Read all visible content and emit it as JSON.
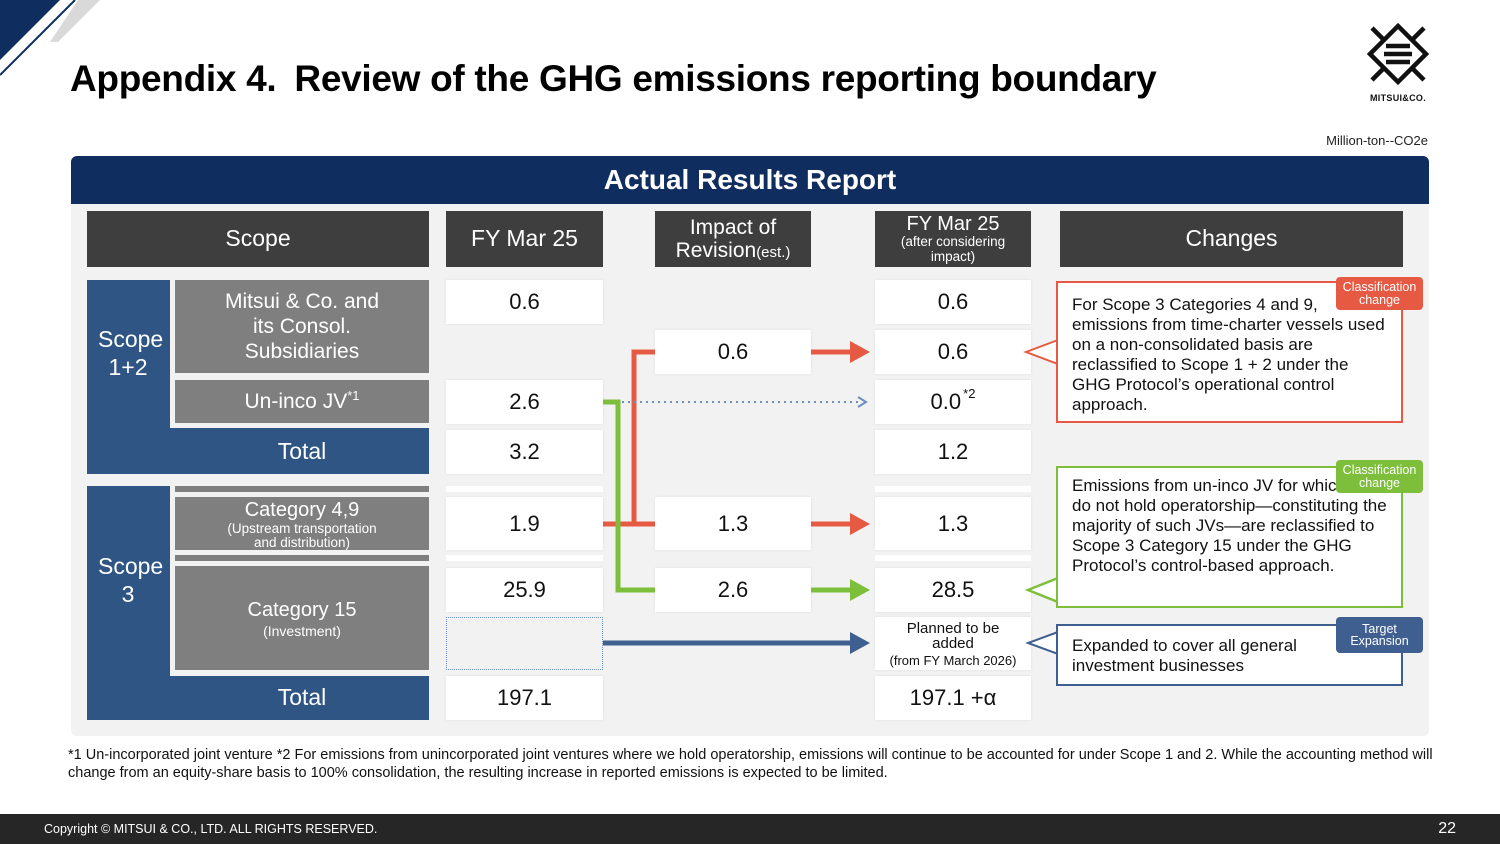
{
  "header": {
    "title_prefix": "Appendix 4.",
    "title": "Review of the GHG emissions reporting boundary",
    "unit": "Million-ton--CO2e",
    "logo_text": "MITSUI&CO."
  },
  "panel": {
    "title": "Actual Results Report"
  },
  "columns": {
    "scope": "Scope",
    "fy": "FY Mar 25",
    "impact_line1": "Impact of",
    "impact_line2": "Revision",
    "impact_est": "(est.)",
    "fy_after_line1": "FY Mar 25",
    "fy_after_line2": "(after considering impact)",
    "changes": "Changes"
  },
  "rows": {
    "scope12_label": "Scope 1+2",
    "mitsui_consol": "Mitsui & Co. and its Consol. Subsidiaries",
    "unincojv": "Un-inco JV",
    "unincojv_sup": "*1",
    "total": "Total",
    "scope3_label": "Scope 3",
    "cat49": "Category 4,9",
    "cat49_sub": "(Upstream transportation and distribution)",
    "cat15": "Category 15",
    "cat15_sub": "(Investment)",
    "total3": "Total"
  },
  "values": {
    "consol_fy": "0.6",
    "consol_after": "0.6",
    "consol_impact": "0.6",
    "consol_after2": "0.6",
    "jv_fy": "2.6",
    "jv_after": "0.0",
    "jv_after_sup": "*2",
    "total12_fy": "3.2",
    "total12_after": "1.2",
    "cat49_fy": "1.9",
    "cat49_impact": "1.3",
    "cat49_after": "1.3",
    "cat15_fy": "25.9",
    "cat15_impact": "2.6",
    "cat15_after": "28.5",
    "planned_line1": "Planned to be added",
    "planned_line2": "(from FY March 2026)",
    "total3_fy": "197.1",
    "total3_after": "197.1 +α"
  },
  "changes": [
    {
      "tag": "Classification change",
      "text": "For Scope 3 Categories 4 and 9, emissions from time-charter vessels used on a non-consolidated basis are reclassified to Scope 1 + 2 under the GHG Protocol’s operational control approach.",
      "color": "#e65a44"
    },
    {
      "tag": "Classification change",
      "text": "Emissions from un-inco JV for which we do not hold operatorship—constituting the majority of such JVs—are reclassified to Scope 3 Category 15 under the GHG Protocol’s control-based approach.",
      "color": "#7dbf3b"
    },
    {
      "tag": "Target Expansion",
      "text": "Expanded to cover all general investment businesses",
      "color": "#3f5f90"
    }
  ],
  "footnote": "*1 Un-incorporated joint venture  *2 For emissions from unincorporated joint ventures where we hold operatorship, emissions will continue to be accounted for under Scope 1 and 2. While the accounting method will change from an equity-share basis to 100% consolidation, the resulting increase in reported emissions is expected to be limited.",
  "footer": {
    "copyright": "Copyright © MITSUI & CO., LTD. ALL RIGHTS RESERVED.",
    "page": "22"
  },
  "colors": {
    "navy": "#0f2d5f",
    "scope_blue": "#2f5584",
    "red": "#e65a44",
    "green": "#7dbf3b",
    "arrow_blue": "#3f5f90"
  }
}
